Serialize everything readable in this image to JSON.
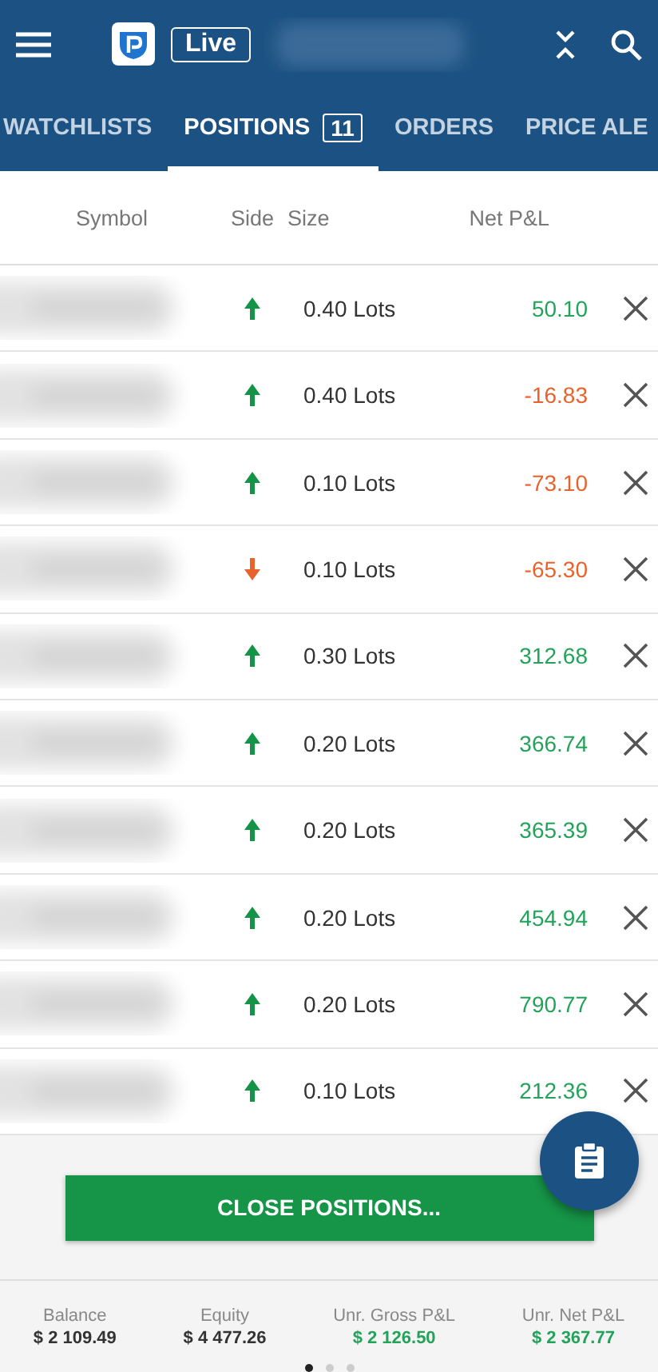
{
  "header": {
    "badge": "Live"
  },
  "tabs": [
    {
      "label": "WATCHLISTS",
      "selected": false
    },
    {
      "label": "POSITIONS",
      "count": "11",
      "selected": true
    },
    {
      "label": "ORDERS",
      "selected": false
    },
    {
      "label": "PRICE ALE",
      "selected": false
    }
  ],
  "columns": [
    "Symbol",
    "Side",
    "Size",
    "Net P&L"
  ],
  "rows": [
    {
      "kind": "up",
      "size": "0.40 Lots",
      "pnl": "50.10",
      "profit": true
    },
    {
      "kind": "up",
      "size": "0.40 Lots",
      "pnl": "-16.83",
      "profit": false
    },
    {
      "kind": "up",
      "size": "0.10 Lots",
      "pnl": "-73.10",
      "profit": false
    },
    {
      "kind": "down",
      "size": "0.10 Lots",
      "pnl": "-65.30",
      "profit": false
    },
    {
      "kind": "up",
      "size": "0.30 Lots",
      "pnl": "312.68",
      "profit": true
    },
    {
      "kind": "up",
      "size": "0.20 Lots",
      "pnl": "366.74",
      "profit": true
    },
    {
      "kind": "up",
      "size": "0.20 Lots",
      "pnl": "365.39",
      "profit": true
    },
    {
      "kind": "up",
      "size": "0.20 Lots",
      "pnl": "454.94",
      "profit": true
    },
    {
      "kind": "up",
      "size": "0.20 Lots",
      "pnl": "790.77",
      "profit": true
    },
    {
      "kind": "up",
      "size": "0.10 Lots",
      "pnl": "212.36",
      "profit": true
    }
  ],
  "close_button": "CLOSE POSITIONS...",
  "summary": [
    {
      "label": "Balance",
      "value": "$ 2 109.49",
      "profit": false
    },
    {
      "label": "Equity",
      "value": "$ 4 477.26",
      "profit": false
    },
    {
      "label": "Unr. Gross P&L",
      "value": "$ 2 126.50",
      "profit": true
    },
    {
      "label": "Unr. Net P&L",
      "value": "$ 2 367.77",
      "profit": true
    }
  ],
  "pages": [
    {
      "selected": true
    },
    {
      "selected": false
    },
    {
      "selected": false
    }
  ]
}
